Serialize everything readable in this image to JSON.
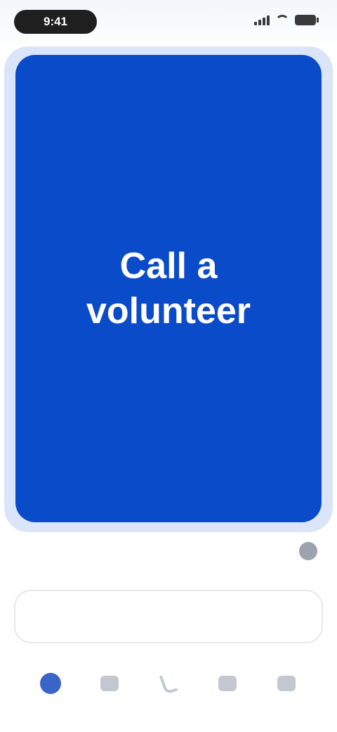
{
  "status_bar": {
    "time": "9:41"
  },
  "main": {
    "call_button_label": "Call a volunteer"
  },
  "info": {
    "left_caption": "",
    "left_value": "",
    "right_text": ""
  },
  "secondary_button": {
    "label": ""
  },
  "bottom_nav": {
    "items": [
      {
        "label": ""
      },
      {
        "label": ""
      },
      {
        "label": ""
      },
      {
        "label": ""
      },
      {
        "label": ""
      }
    ]
  },
  "colors": {
    "primary": "#0a4bc9",
    "halo": "#dbe5fa",
    "nav_active": "#3b64c8"
  }
}
